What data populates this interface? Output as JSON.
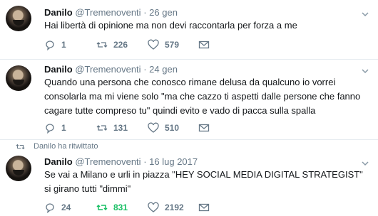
{
  "tweets": [
    {
      "name": "Danilo",
      "handle": "@Tremenoventi",
      "separator": "·",
      "date": "26 gen",
      "text": "Hai libertà di opinione ma non devi raccontarla per forza a me",
      "replies": "1",
      "retweets": "226",
      "likes": "579"
    },
    {
      "name": "Danilo",
      "handle": "@Tremenoventi",
      "separator": "·",
      "date": "24 gen",
      "text": "Quando una persona che conosco rimane delusa da qualcuno io vorrei consolarla ma mi viene solo \"ma che cazzo ti aspetti dalle persone che fanno cagare tutte compreso tu\" quindi evito e vado di pacca sulla spalla",
      "replies": "1",
      "retweets": "131",
      "likes": "510"
    },
    {
      "retweet_note": "Danilo ha ritwittato",
      "name": "Danilo",
      "handle": "@Tremenoventi",
      "separator": "·",
      "date": "16 lug 2017",
      "text": "Se vai a Milano e urli in piazza \"HEY SOCIAL MEDIA DIGITAL STRATEGIST\" si girano tutti \"dimmi\"",
      "replies": "24",
      "retweets": "831",
      "likes": "2192"
    }
  ],
  "icons": {
    "reply": "reply-icon",
    "retweet": "retweet-icon",
    "like": "heart-icon",
    "dm": "envelope-icon",
    "menu": "chevron-down-icon"
  },
  "colors": {
    "retweet_active": "#17bf63",
    "muted": "#657786",
    "divider": "#e6ecf0"
  }
}
